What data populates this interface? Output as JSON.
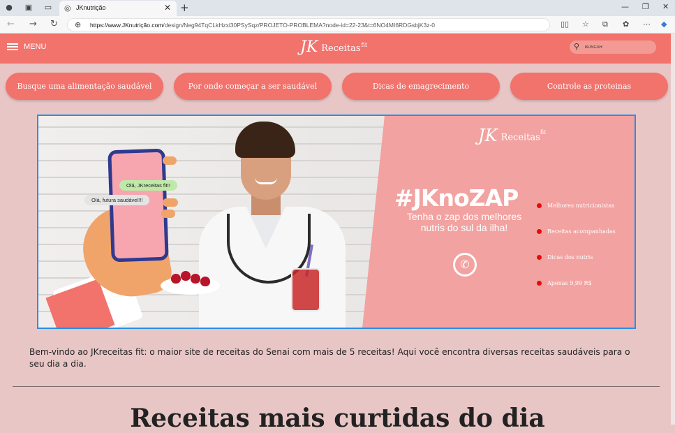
{
  "browser": {
    "tab_title": "JKnutrição",
    "url_host": "https://www.JKnutrição.com",
    "url_path": "/design/Neg94TqCLkHzxi30PSySqz/PROJETO-PROBLEMA?node-id=22-23&t=6NO4MI6RDGsbjK3z-0"
  },
  "header": {
    "menu_label": "MENU",
    "logo_mark": "JK",
    "logo_name": "Receitas",
    "logo_sup": "fit",
    "search_placeholder": "BUSCAR"
  },
  "categories": [
    "Busque uma alimentação saudável",
    "Por onde começar a ser saudável",
    "Dicas de emagrecimento",
    "Controle as proteinas"
  ],
  "banner": {
    "bubble_1": "Olá, JKreceitas fit!!",
    "bubble_2": "Olá, futura saudável!!!",
    "logo_mark": "JK",
    "logo_name": "Receitas",
    "logo_sup": "fit",
    "hashtag": "#JKnoZAP",
    "tagline": "Tenha o zap dos melhores nutris do sul da ilha!",
    "features": [
      "Melhores nutricionistas",
      "Receitas acompanhadas",
      "Dicas dos nutris",
      "Apenas 9,99 R$"
    ]
  },
  "intro_text": "Bem-vindo ao JKreceitas fit: o maior site de receitas do Senai com mais de 5 receitas! Aqui você encontra diversas receitas saudáveis para o seu dia a dia.",
  "section_title": "Receitas mais curtidas do dia"
}
